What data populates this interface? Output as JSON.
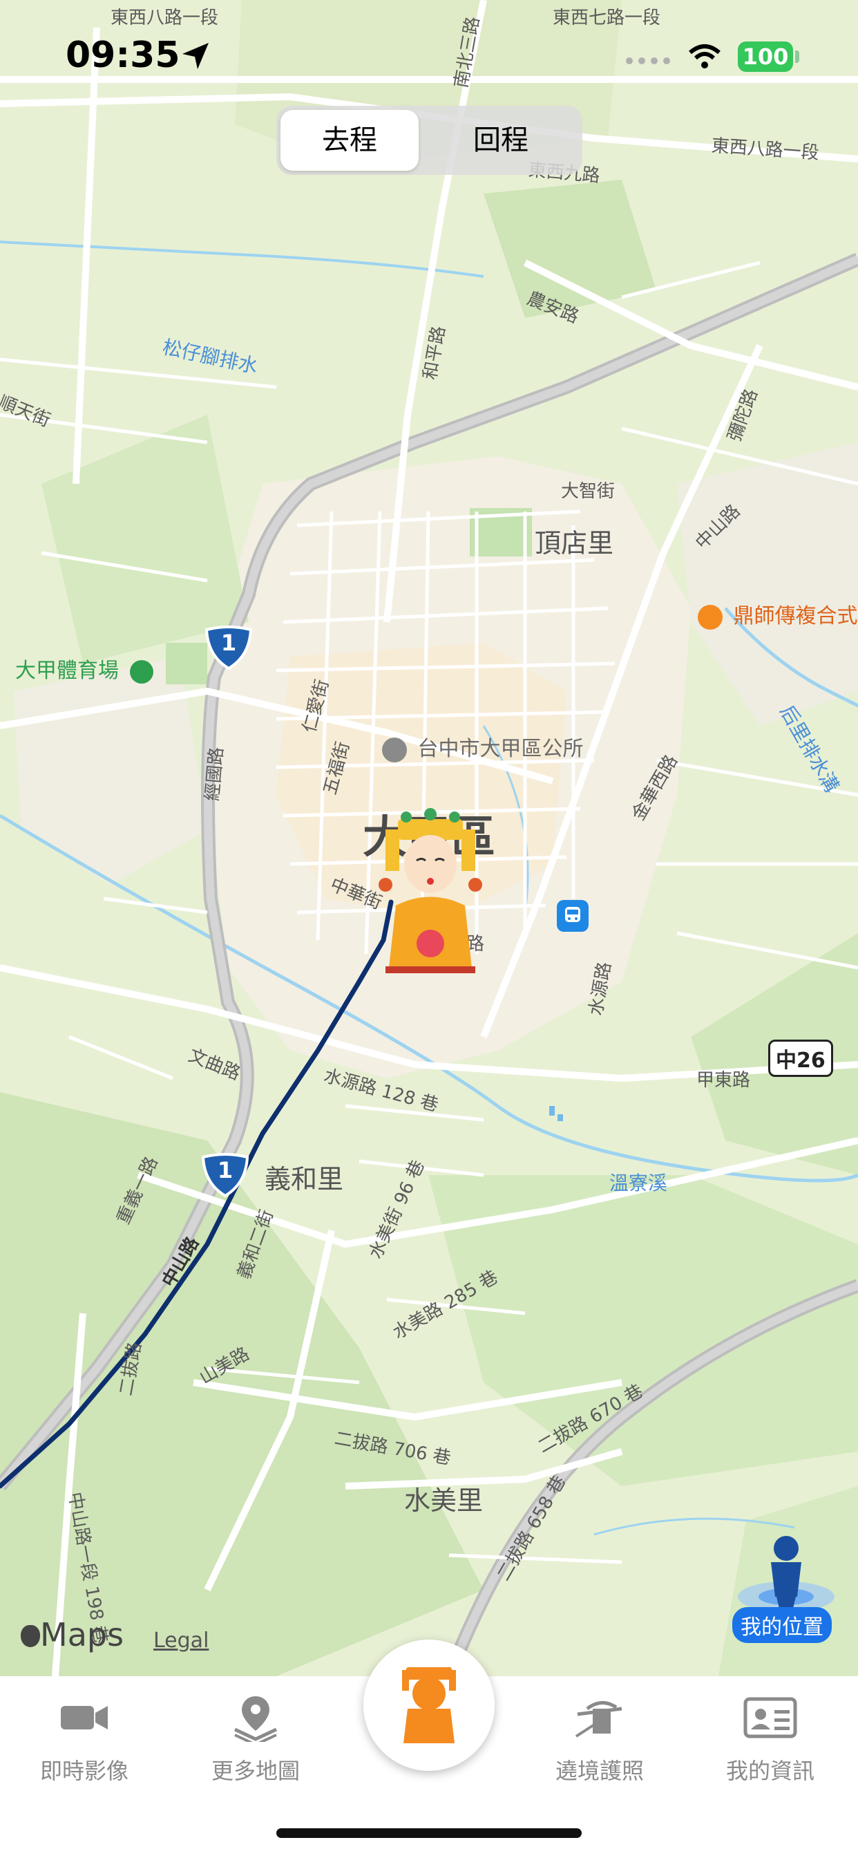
{
  "status_bar": {
    "time": "09:35",
    "battery": "100"
  },
  "direction_toggle": {
    "outbound": "去程",
    "return": "回程",
    "selected": "去程"
  },
  "map": {
    "areas": {
      "district": "大甲區",
      "dingdian": "頂店里",
      "yihe": "義和里",
      "shuimei": "水美里"
    },
    "pois": {
      "stadium": "大甲體育場",
      "restaurant": "鼎師傳複合式",
      "district_office": "台中市大甲區公所"
    },
    "waters": {
      "songzijiao": "松仔腳排水",
      "wenliao": "溫寮溪",
      "houli": "后里排水溝"
    },
    "roads": {
      "dongxi8": "東西八路一段",
      "dongxi7": "東西七路一段",
      "dongxi8b": "東西八路一段",
      "dongxi9": "東西九路",
      "nanbei3": "南北三路",
      "nongan": "農安路",
      "heping": "和平路",
      "shuntian": "順天街",
      "mituo": "彌陀路",
      "dazhi": "大智街",
      "zhongshan_ne": "中山路",
      "jingguo": "經國路",
      "renai": "仁愛街",
      "wufu": "五福街",
      "zhonghua": "中華街",
      "lu": "路",
      "jinhua_w": "金華西路",
      "shuiyuan": "水源路",
      "shuiyuan128": "水源路 128 巷",
      "wenqu": "文曲路",
      "jiadong": "甲東路",
      "chongyi1": "重義一路",
      "zhongshan_sw": "中山路",
      "yihe2": "義和二街",
      "shuimei96": "水美街 96 巷",
      "shuimei285": "水美路 285 巷",
      "shanmei": "山美路",
      "erba": "二拔路",
      "erba706": "二拔路 706 巷",
      "erba670": "二拔路 670 巷",
      "erba658": "二拔路 658 巷",
      "zhongshan1_198": "中山路一段 198 巷"
    },
    "highway_shield_number": "1",
    "route_shield": "中26",
    "attribution": "Maps",
    "legal": "Legal",
    "my_location_label": "我的位置"
  },
  "tabbar": {
    "live": "即時影像",
    "more_maps": "更多地圖",
    "passport": "遶境護照",
    "my_info": "我的資訊"
  },
  "colors": {
    "route_line": "#0d2f6e",
    "accent_orange": "#f58a1f",
    "location_blue": "#1a73e8",
    "battery_green": "#34c759"
  }
}
